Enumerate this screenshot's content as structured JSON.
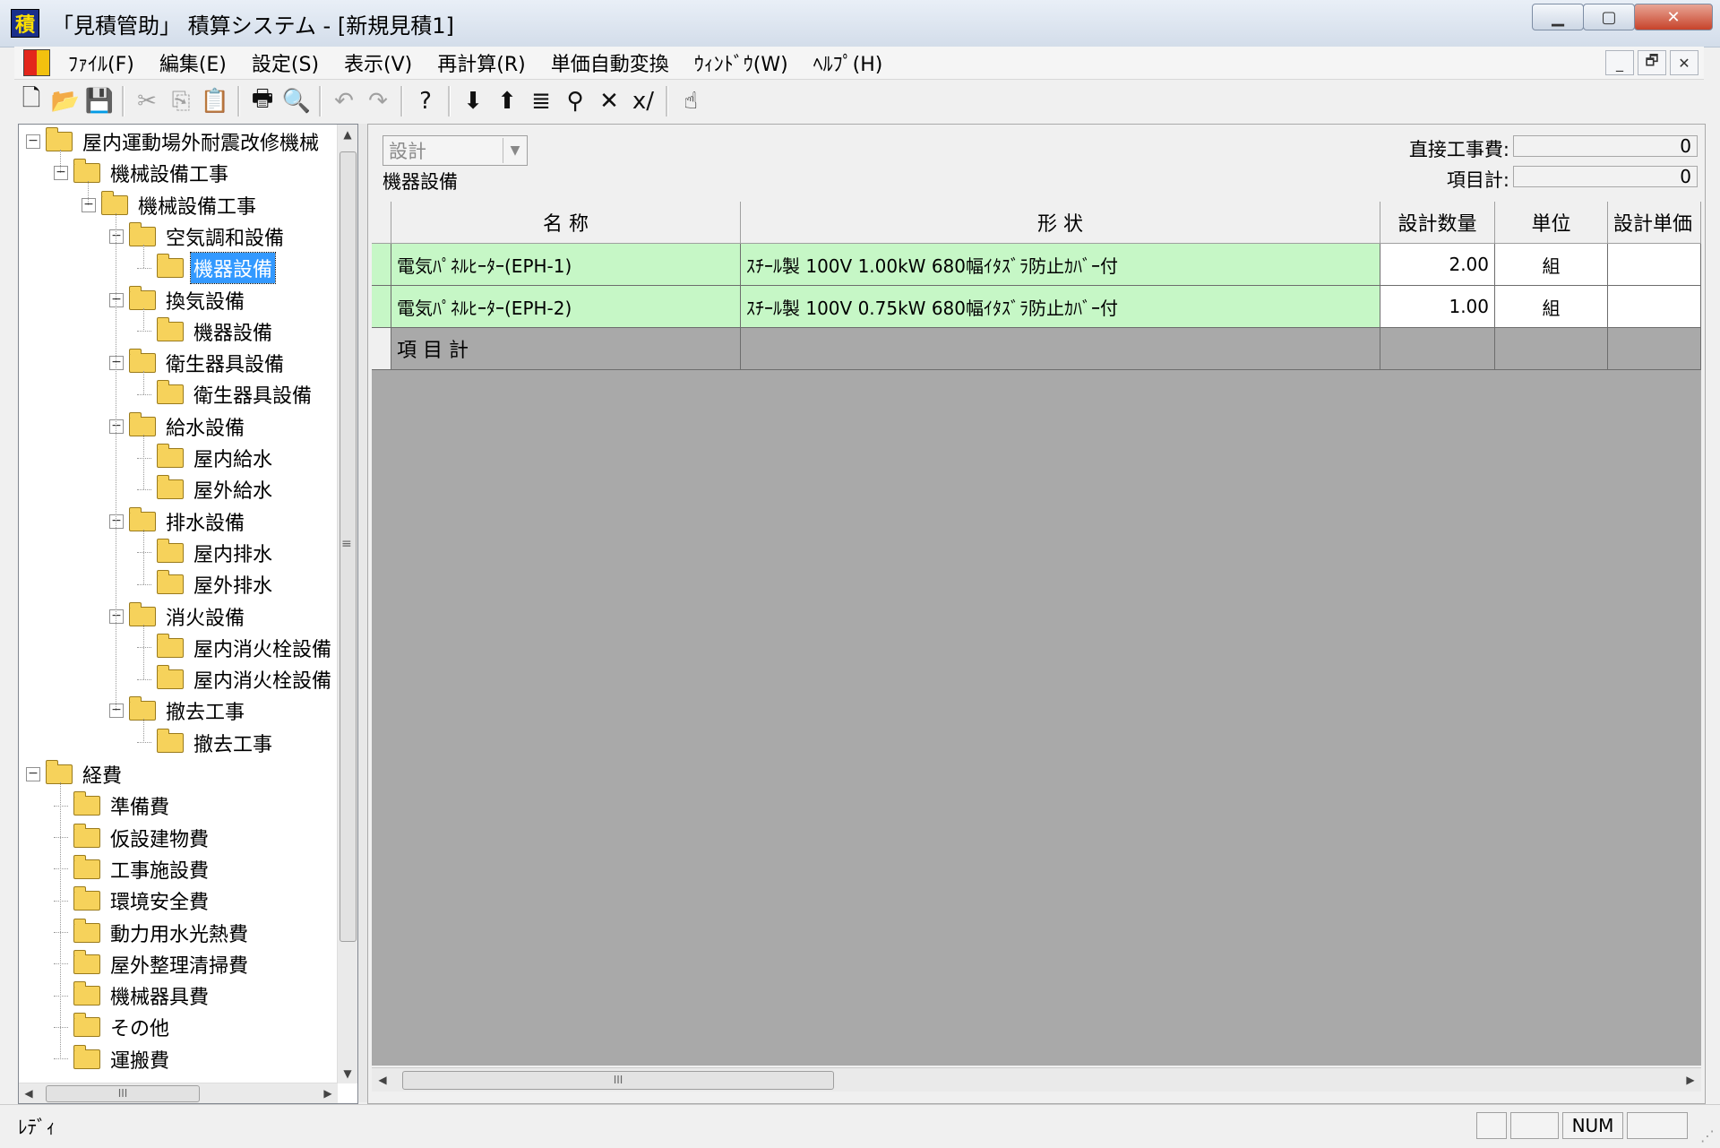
{
  "window": {
    "title": "「見積管助」 積算システム - [新規見積1]",
    "app_icon_glyph": "積",
    "buttons": {
      "minimize": "▁",
      "maximize": "▢",
      "close": "✕"
    }
  },
  "menu": {
    "items": [
      "ﾌｧｲﾙ(F)",
      "編集(E)",
      "設定(S)",
      "表示(V)",
      "再計算(R)",
      "単価自動変換",
      "ｳｨﾝﾄﾞｳ(W)",
      "ﾍﾙﾌﾟ(H)"
    ],
    "mdi_buttons": [
      "_",
      "🗗",
      "✕"
    ]
  },
  "toolbar": {
    "buttons": [
      {
        "icon": "new-file-icon",
        "glyph": "🗋",
        "enabled": true
      },
      {
        "icon": "open-folder-icon",
        "glyph": "📂",
        "enabled": true
      },
      {
        "icon": "save-icon",
        "glyph": "💾",
        "enabled": true
      },
      {
        "sep": true
      },
      {
        "icon": "cut-icon",
        "glyph": "✂",
        "enabled": false
      },
      {
        "icon": "copy-icon",
        "glyph": "⎘",
        "enabled": false
      },
      {
        "icon": "paste-icon",
        "glyph": "📋",
        "enabled": false
      },
      {
        "sep": true
      },
      {
        "icon": "print-icon",
        "glyph": "🖶",
        "enabled": true
      },
      {
        "icon": "print-preview-icon",
        "glyph": "🔍",
        "enabled": true
      },
      {
        "sep": true
      },
      {
        "icon": "undo-icon",
        "glyph": "↶",
        "enabled": false
      },
      {
        "icon": "redo-icon",
        "glyph": "↷",
        "enabled": false
      },
      {
        "sep": true
      },
      {
        "icon": "help-icon",
        "glyph": "?",
        "enabled": true
      },
      {
        "sep": true
      },
      {
        "icon": "move-down-icon",
        "glyph": "⬇",
        "enabled": true
      },
      {
        "icon": "move-up-icon",
        "glyph": "⬆",
        "enabled": true
      },
      {
        "icon": "list-icon",
        "glyph": "≣",
        "enabled": true
      },
      {
        "icon": "find-icon",
        "glyph": "⚲",
        "enabled": true
      },
      {
        "icon": "delete-icon",
        "glyph": "✕",
        "enabled": true
      },
      {
        "icon": "multiply-icon",
        "glyph": "x/",
        "enabled": true
      },
      {
        "sep": true
      },
      {
        "icon": "pointer-help-icon",
        "glyph": "☝",
        "enabled": true
      }
    ]
  },
  "tree": {
    "nodes": [
      {
        "label": "屋内運動場外耐震改修機械",
        "level": 0,
        "expandable": true,
        "selected": false
      },
      {
        "label": "機械設備工事",
        "level": 1,
        "expandable": true,
        "selected": false
      },
      {
        "label": "機械設備工事",
        "level": 2,
        "expandable": true,
        "selected": false
      },
      {
        "label": "空気調和設備",
        "level": 3,
        "expandable": true,
        "selected": false
      },
      {
        "label": "機器設備",
        "level": 4,
        "expandable": false,
        "selected": true
      },
      {
        "label": "換気設備",
        "level": 3,
        "expandable": true,
        "selected": false
      },
      {
        "label": "機器設備",
        "level": 4,
        "expandable": false,
        "selected": false
      },
      {
        "label": "衛生器具設備",
        "level": 3,
        "expandable": true,
        "selected": false
      },
      {
        "label": "衛生器具設備",
        "level": 4,
        "expandable": false,
        "selected": false
      },
      {
        "label": "給水設備",
        "level": 3,
        "expandable": true,
        "selected": false
      },
      {
        "label": "屋内給水",
        "level": 4,
        "expandable": false,
        "selected": false
      },
      {
        "label": "屋外給水",
        "level": 4,
        "expandable": false,
        "selected": false
      },
      {
        "label": "排水設備",
        "level": 3,
        "expandable": true,
        "selected": false
      },
      {
        "label": "屋内排水",
        "level": 4,
        "expandable": false,
        "selected": false
      },
      {
        "label": "屋外排水",
        "level": 4,
        "expandable": false,
        "selected": false
      },
      {
        "label": "消火設備",
        "level": 3,
        "expandable": true,
        "selected": false
      },
      {
        "label": "屋内消火栓設備",
        "level": 4,
        "expandable": false,
        "selected": false
      },
      {
        "label": "屋内消火栓設備",
        "level": 4,
        "expandable": false,
        "selected": false
      },
      {
        "label": "撤去工事",
        "level": 3,
        "expandable": true,
        "selected": false
      },
      {
        "label": "撤去工事",
        "level": 4,
        "expandable": false,
        "selected": false
      },
      {
        "label": "経費",
        "level": 0,
        "expandable": true,
        "selected": false
      },
      {
        "label": "準備費",
        "level": 1,
        "expandable": false,
        "selected": false
      },
      {
        "label": "仮設建物費",
        "level": 1,
        "expandable": false,
        "selected": false
      },
      {
        "label": "工事施設費",
        "level": 1,
        "expandable": false,
        "selected": false
      },
      {
        "label": "環境安全費",
        "level": 1,
        "expandable": false,
        "selected": false
      },
      {
        "label": "動力用水光熱費",
        "level": 1,
        "expandable": false,
        "selected": false
      },
      {
        "label": "屋外整理清掃費",
        "level": 1,
        "expandable": false,
        "selected": false
      },
      {
        "label": "機械器具費",
        "level": 1,
        "expandable": false,
        "selected": false
      },
      {
        "label": "その他",
        "level": 1,
        "expandable": false,
        "selected": false
      },
      {
        "label": "運搬費",
        "level": 1,
        "expandable": false,
        "selected": false
      }
    ]
  },
  "detail": {
    "mode_select": {
      "value": "設計"
    },
    "section_label": "機器設備",
    "summary": [
      {
        "label": "直接工事費:",
        "value": "0"
      },
      {
        "label": "項目計:",
        "value": "0"
      }
    ],
    "grid": {
      "columns": [
        "名 称",
        "形 状",
        "設計数量",
        "単位",
        "設計単価"
      ],
      "rows": [
        {
          "name": "電気ﾊﾟﾈﾙﾋｰﾀｰ(EPH-1)",
          "shape": "ｽﾁｰﾙ製 100V 1.00kW 680幅ｲﾀｽﾞﾗ防止ｶﾊﾞｰ付",
          "qty": "2.00",
          "unit": "組",
          "price": ""
        },
        {
          "name": "電気ﾊﾟﾈﾙﾋｰﾀｰ(EPH-2)",
          "shape": "ｽﾁｰﾙ製 100V 0.75kW 680幅ｲﾀｽﾞﾗ防止ｶﾊﾞｰ付",
          "qty": "1.00",
          "unit": "組",
          "price": ""
        }
      ],
      "total_label": "項 目 計"
    }
  },
  "status": {
    "text": "ﾚﾃﾞｨ",
    "panels": [
      "",
      "",
      "NUM",
      ""
    ]
  },
  "colors": {
    "row_highlight": "#c6f7c6",
    "grid_background": "#a9a9a9",
    "selection": "#3399ff"
  }
}
